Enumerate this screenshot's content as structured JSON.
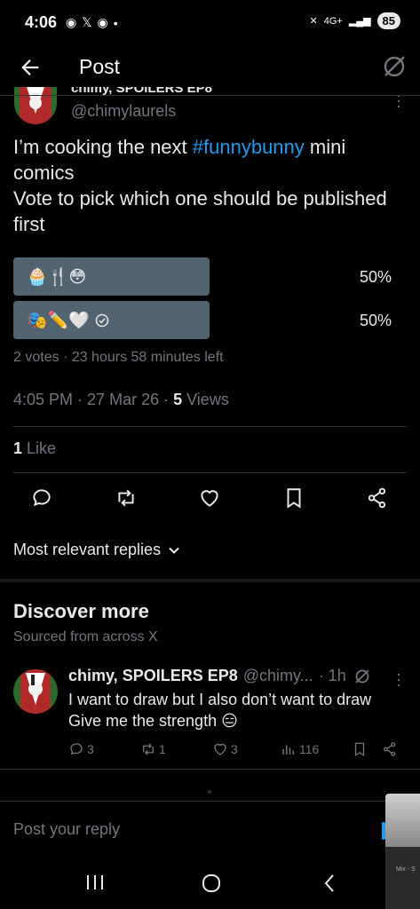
{
  "status_bar": {
    "time": "4:06",
    "network": "4G+",
    "battery": "85"
  },
  "header": {
    "title": "Post"
  },
  "post": {
    "author_name": "chimy, SPOILERS EP8",
    "handle": "@chimylaurels",
    "text_before": "I’m cooking the next ",
    "hashtag": "#funnybunny",
    "text_after": " mini comics\nVote to pick which one should be published first",
    "poll": {
      "options": [
        {
          "label": "🧁🍴😳",
          "percent": "50%",
          "fill": 0.5,
          "voted": false
        },
        {
          "label": "🎭✏️🤍",
          "percent": "50%",
          "fill": 0.5,
          "voted": true
        }
      ],
      "votes": "2 votes",
      "time_left": "23 hours 58 minutes left"
    },
    "time": "4:05 PM",
    "date": "27 Mar 26",
    "views_count": "5",
    "views_label": "Views",
    "likes_count": "1",
    "likes_label": "Like"
  },
  "actions": [
    "reply-icon",
    "repost-icon",
    "like-icon",
    "bookmark-icon",
    "share-icon"
  ],
  "replies": {
    "sort_label": "Most relevant replies"
  },
  "discover": {
    "title": "Discover more",
    "subtitle": "Sourced from across X",
    "post": {
      "name": "chimy, SPOILERS EP8",
      "handle": "@chimy...",
      "age": "· 1h",
      "text": "I want to draw but I also don’t want to draw Give me the strength 😑",
      "replies": "3",
      "reposts": "1",
      "likes": "3",
      "views": "116"
    }
  },
  "reply_box": {
    "placeholder": "Post your reply"
  },
  "thumbnail": {
    "text": "Mix - S"
  },
  "colors": {
    "accent": "#1d9bf0",
    "poll_fill": "#536471",
    "muted": "#71767b"
  }
}
